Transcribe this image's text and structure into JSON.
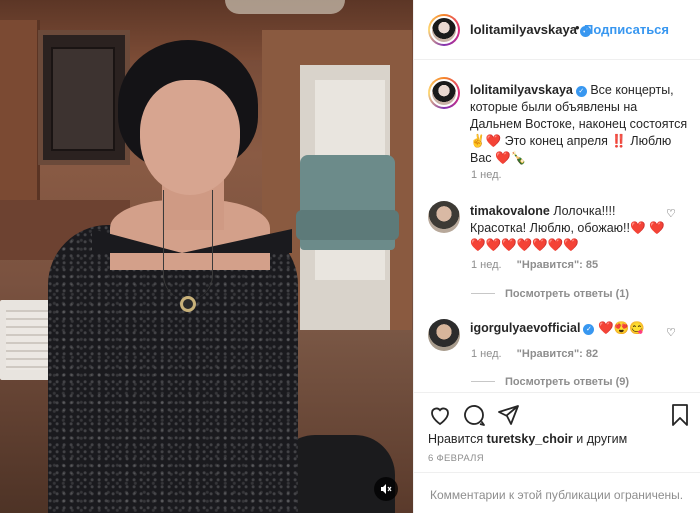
{
  "post": {
    "author": "lolitamilyavskaya",
    "follow_label": "Подписаться",
    "follow_separator": "•",
    "caption": "Все концерты, которые были объявлены на Дальнем Востоке, наконец состоятся ✌️❤️ Это конец апреля ‼️ Люблю Вас ❤️🍾",
    "caption_time": "1 нед.",
    "likes_prefix": "Нравится",
    "likes_user": "turetsky_choir",
    "likes_suffix": "и другим",
    "date": "6 ФЕВРАЛЯ",
    "comments_limited": "Комментарии к этой публикации ограничены."
  },
  "comments": [
    {
      "username": "timakovalone",
      "text": "Лолочка!!!! Красотка! Люблю, обожаю!!❤️ ❤️❤️❤️❤️❤️❤️❤️❤️",
      "time": "1 нед.",
      "likes": "\"Нравится\": 85",
      "replies": "Посмотреть ответы (1)"
    },
    {
      "username": "igorgulyaevofficial",
      "text": "❤️😍😋",
      "time": "1 нед.",
      "likes": "\"Нравится\": 82",
      "replies": "Посмотреть ответы (9)"
    }
  ],
  "icons": {
    "like": "heart-icon",
    "comment": "comment-icon",
    "share": "share-icon",
    "save": "bookmark-icon",
    "mute": "speaker-muted-icon",
    "verified": "verified-badge-icon"
  },
  "colors": {
    "accent": "#3897f0",
    "muted_text": "#8e8e8e"
  }
}
